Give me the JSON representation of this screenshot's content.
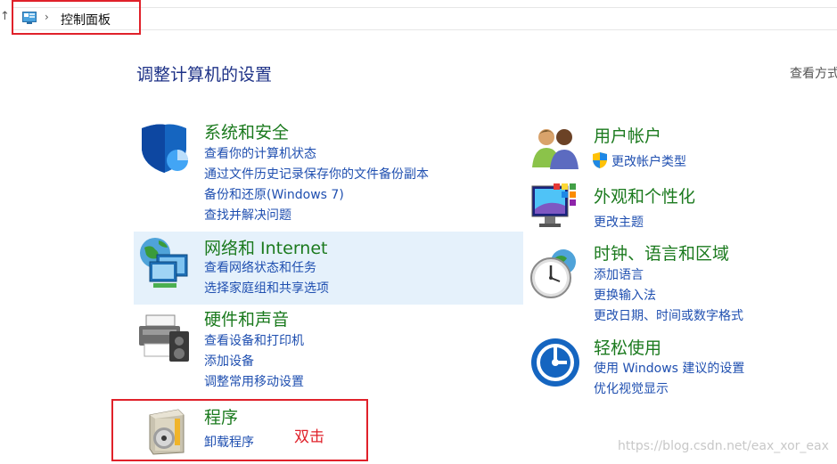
{
  "address_bar": {
    "up_arrow": "↑",
    "separator": "›",
    "breadcrumb": "控制面板"
  },
  "page_title": "调整计算机的设置",
  "view_by": "查看方式",
  "categories": {
    "system_security": {
      "title": "系统和安全",
      "links": [
        "查看你的计算机状态",
        "通过文件历史记录保存你的文件备份副本",
        "备份和还原(Windows 7)",
        "查找并解决问题"
      ]
    },
    "network": {
      "title": "网络和 Internet",
      "links": [
        "查看网络状态和任务",
        "选择家庭组和共享选项"
      ]
    },
    "hardware": {
      "title": "硬件和声音",
      "links": [
        "查看设备和打印机",
        "添加设备",
        "调整常用移动设置"
      ]
    },
    "programs": {
      "title": "程序",
      "links": [
        "卸载程序"
      ]
    },
    "user_accounts": {
      "title": "用户帐户",
      "links": [
        "更改帐户类型"
      ]
    },
    "appearance": {
      "title": "外观和个性化",
      "links": [
        "更改主题"
      ]
    },
    "clock_region": {
      "title": "时钟、语言和区域",
      "links": [
        "添加语言",
        "更换输入法",
        "更改日期、时间或数字格式"
      ]
    },
    "ease_of_access": {
      "title": "轻松使用",
      "links": [
        "使用 Windows 建议的设置",
        "优化视觉显示"
      ]
    }
  },
  "annotation": "双击",
  "watermark": "https://blog.csdn.net/eax_xor_eax",
  "colors": {
    "category_title": "#1b7a1e",
    "link": "#1f4fb0",
    "page_title": "#1e3287",
    "highlight": "#e5f1fb",
    "annotation_red": "#e0212a"
  }
}
